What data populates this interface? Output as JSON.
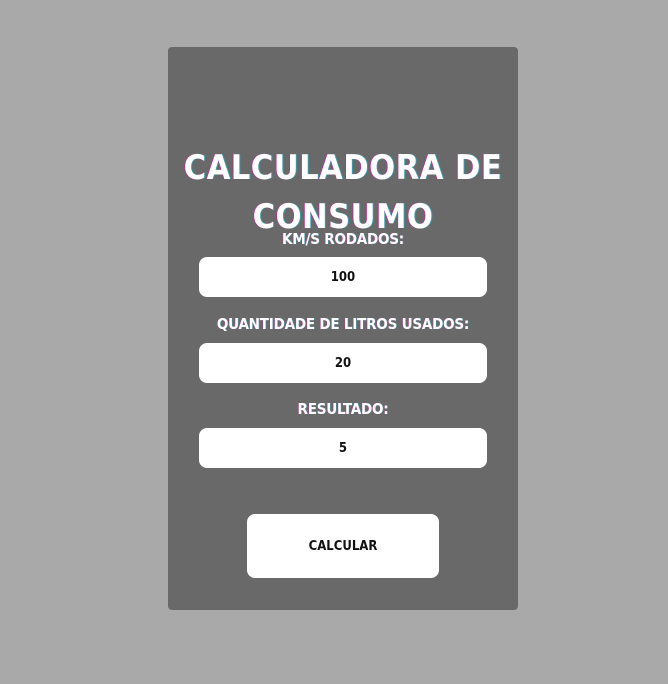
{
  "title_line1": "CALCULADORA DE",
  "title_line2": "CONSUMO",
  "km": {
    "label": "KM/S RODADOS:",
    "value": "100"
  },
  "litros": {
    "label": "QUANTIDADE DE LITROS USADOS:",
    "value": "20"
  },
  "resultado": {
    "label": "RESULTADO:",
    "value": "5"
  },
  "button_label": "CALCULAR",
  "colors": {
    "page_background": "#a9a9a9",
    "card_background": "#696969",
    "field_background": "#ffffff",
    "text_light": "#ffffff",
    "text_dark": "#111111"
  }
}
